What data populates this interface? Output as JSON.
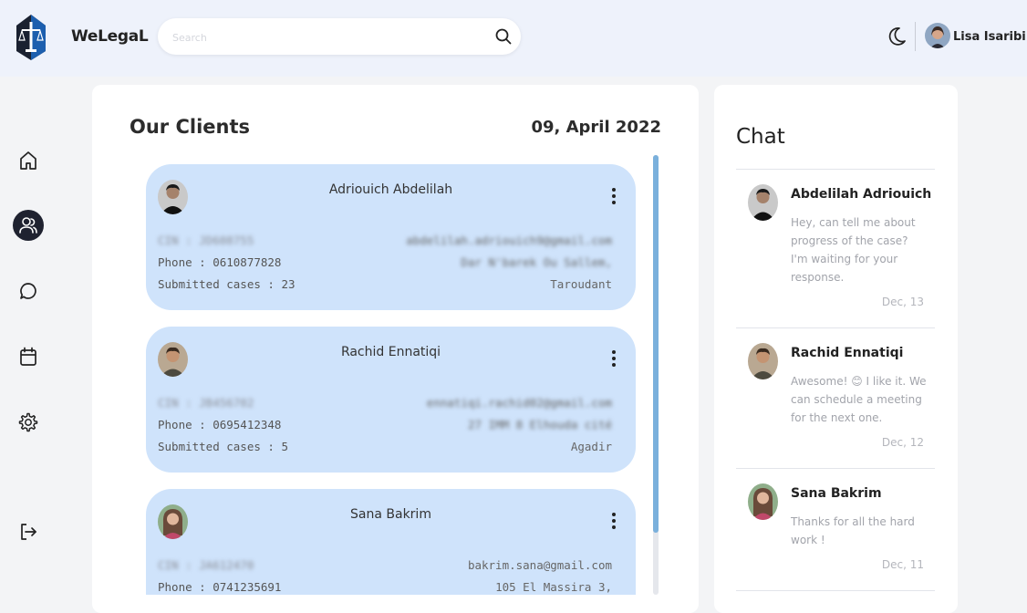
{
  "app": {
    "brand": "WeLegaL",
    "search_placeholder": "Search",
    "user_name": "Lisa Isaribi",
    "accent": "#cfe3fb",
    "dark": "#1f2230"
  },
  "sidebar": {
    "items": [
      {
        "icon": "home-icon"
      },
      {
        "icon": "users-icon",
        "active": true
      },
      {
        "icon": "chat-icon"
      },
      {
        "icon": "calendar-icon"
      },
      {
        "icon": "settings-icon"
      },
      {
        "icon": "logout-icon"
      }
    ]
  },
  "clients": {
    "title": "Our Clients",
    "date": "09, April 2022",
    "items": [
      {
        "name": "Adriouich Abdelilah",
        "cin": "CIN : JD608755",
        "email": "abdelilah.adriouich9@gmail.com",
        "phone": "Phone : 0610877828",
        "address1": "Dar N'barek Ou Sallem,",
        "cases": "Submitted cases : 23",
        "address2": "Taroudant"
      },
      {
        "name": "Rachid Ennatiqi",
        "cin": "CIN : JB456702",
        "email": "ennatiqi.rachid02@gmail.com",
        "phone": "Phone : 0695412348",
        "address1": "27 IMM 8 Elhouda cité",
        "cases": "Submitted cases : 5",
        "address2": "Agadir"
      },
      {
        "name": "Sana Bakrim",
        "cin": "CIN : JA612470",
        "email": "bakrim.sana@gmail.com",
        "phone": "Phone : 0741235691",
        "address1": "105 El Massira 3,",
        "cases": "",
        "address2": ""
      }
    ]
  },
  "chat": {
    "title": "Chat",
    "items": [
      {
        "name": "Abdelilah Adriouich",
        "message": "Hey, can tell me about progress of the case? I'm waiting for your response.",
        "date": "Dec, 13"
      },
      {
        "name": "Rachid Ennatiqi",
        "message": "Awesome! 😊 I like it. We can schedule a meeting for the next one.",
        "date": "Dec, 12"
      },
      {
        "name": "Sana Bakrim",
        "message": "Thanks for all the hard work !",
        "date": "Dec, 11"
      }
    ]
  }
}
